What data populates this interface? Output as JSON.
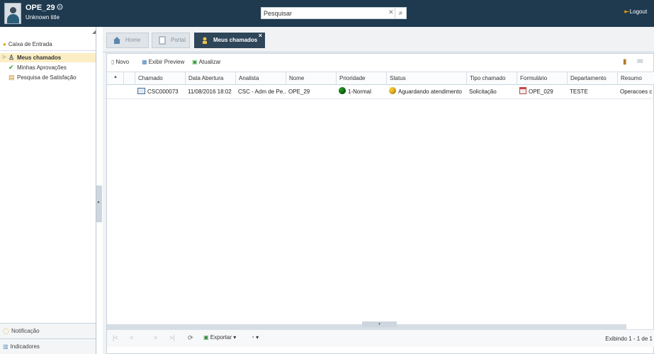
{
  "header": {
    "user_name": "OPE_29",
    "user_title": "Unknown title",
    "search_value": "Pesquisar",
    "logout_label": "Logout"
  },
  "sidebar": {
    "inbox_label": "Caixa de Entrada",
    "items": [
      {
        "label": "Meus chamados",
        "icon": "person-icon",
        "active": true
      },
      {
        "label": "Minhas Aprovações",
        "icon": "checkmark-icon",
        "active": false
      },
      {
        "label": "Pesquisa de Satisfação",
        "icon": "survey-icon",
        "active": false
      }
    ],
    "bottom": [
      {
        "label": "Notificação",
        "icon": "notification-icon"
      },
      {
        "label": "Indicadores",
        "icon": "chart-icon"
      }
    ]
  },
  "tabs": [
    {
      "label": "Home",
      "icon": "home-icon",
      "active": false
    },
    {
      "label": "Portal",
      "icon": "page-icon",
      "active": false
    },
    {
      "label": "Meus chamados",
      "icon": "person-icon",
      "active": true
    }
  ],
  "toolbar": {
    "new_label": "Novo",
    "preview_label": "Exibir Preview",
    "refresh_label": "Atualizar"
  },
  "grid": {
    "columns": [
      "Chamado",
      "Data Abertura",
      "Analista",
      "Nome",
      "Prioridade",
      "Status",
      "Tipo chamado",
      "Formulário",
      "Departamento",
      "Resumo"
    ],
    "rows": [
      {
        "chamado": "CSC000073",
        "data_abertura": "11/08/2016 18:02",
        "analista": "CSC - Adm de Pe...",
        "nome": "OPE_29",
        "prioridade": "1-Normal",
        "status": "Aguardando atendimento",
        "tipo": "Solicitação",
        "formulario": "OPE_029",
        "departamento": "TESTE",
        "resumo": "Operacoes c"
      }
    ]
  },
  "pager": {
    "export_label": "Exportar",
    "status": "Exibindo 1 - 1 de 1"
  },
  "colors": {
    "header_bg": "#1f3a4f",
    "active_tab_bg": "#2f4659",
    "active_item_bg": "#fbeec4",
    "priority_normal": "#1f8f1f",
    "status_waiting": "#f4c531"
  }
}
